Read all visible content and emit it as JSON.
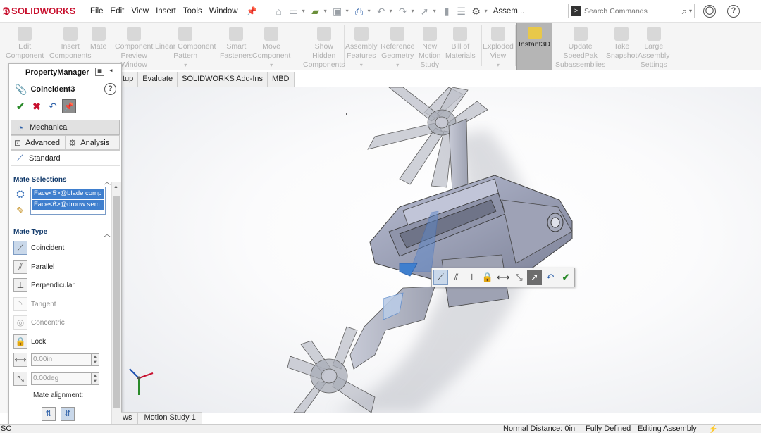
{
  "app": {
    "brand": "SOLIDWORKS",
    "doc_title": "Assem..."
  },
  "menu": [
    "File",
    "Edit",
    "View",
    "Insert",
    "Tools",
    "Window"
  ],
  "search": {
    "placeholder": "Search Commands"
  },
  "ribbon": [
    {
      "label": "Edit",
      "label2": "Component",
      "has_dropdown": false
    },
    {
      "label": "Insert",
      "label2": "Components",
      "has_dropdown": false
    },
    {
      "label": "Mate",
      "label2": "",
      "has_dropdown": false
    },
    {
      "label": "Component",
      "label2": "Preview",
      "label3": "Window",
      "has_dropdown": false
    },
    {
      "label": "Linear Component",
      "label2": "Pattern",
      "has_dropdown": true
    },
    {
      "label": "Smart",
      "label2": "Fasteners",
      "has_dropdown": false
    },
    {
      "label": "Move",
      "label2": "Component",
      "has_dropdown": true
    },
    {
      "label": "Show",
      "label2": "Hidden",
      "label3": "Components",
      "has_dropdown": false
    },
    {
      "label": "Assembly",
      "label2": "Features",
      "has_dropdown": true
    },
    {
      "label": "Reference",
      "label2": "Geometry",
      "has_dropdown": true
    },
    {
      "label": "New",
      "label2": "Motion",
      "label3": "Study",
      "has_dropdown": false
    },
    {
      "label": "Bill of",
      "label2": "Materials",
      "has_dropdown": false
    },
    {
      "label": "Exploded",
      "label2": "View",
      "has_dropdown": true
    },
    {
      "label": "Instant3D",
      "label2": "",
      "active": true
    },
    {
      "label": "Update",
      "label2": "SpeedPak",
      "label3": "Subassemblies",
      "has_dropdown": false
    },
    {
      "label": "Take",
      "label2": "Snapshot",
      "has_dropdown": false
    },
    {
      "label": "Large",
      "label2": "Assembly",
      "label3": "Settings",
      "has_dropdown": false
    }
  ],
  "tabs": [
    "tup",
    "Evaluate",
    "SOLIDWORKS Add-Ins",
    "MBD"
  ],
  "property_manager": {
    "header": "PropertyManager",
    "feature_name": "Coincident3",
    "tabs": {
      "mechanical": "Mechanical",
      "advanced": "Advanced",
      "analysis": "Analysis",
      "standard": "Standard"
    },
    "mate_selections": {
      "title": "Mate Selections",
      "items": [
        "Face<5>@blade comp",
        "Face<6>@dronw sem"
      ]
    },
    "mate_type": {
      "title": "Mate Type",
      "items": [
        {
          "label": "Coincident",
          "selected": true,
          "enabled": true
        },
        {
          "label": "Parallel",
          "selected": false,
          "enabled": true
        },
        {
          "label": "Perpendicular",
          "selected": false,
          "enabled": true
        },
        {
          "label": "Tangent",
          "selected": false,
          "enabled": false
        },
        {
          "label": "Concentric",
          "selected": false,
          "enabled": false
        },
        {
          "label": "Lock",
          "selected": false,
          "enabled": true
        }
      ],
      "distance": "0.00in",
      "angle": "0.00deg",
      "alignment_label": "Mate alignment:"
    }
  },
  "bottom_tabs": [
    "ws",
    "Motion Study 1"
  ],
  "status": {
    "left": "SC",
    "normal_distance": "Normal Distance: 0in",
    "defined": "Fully Defined",
    "mode": "Editing Assembly"
  }
}
